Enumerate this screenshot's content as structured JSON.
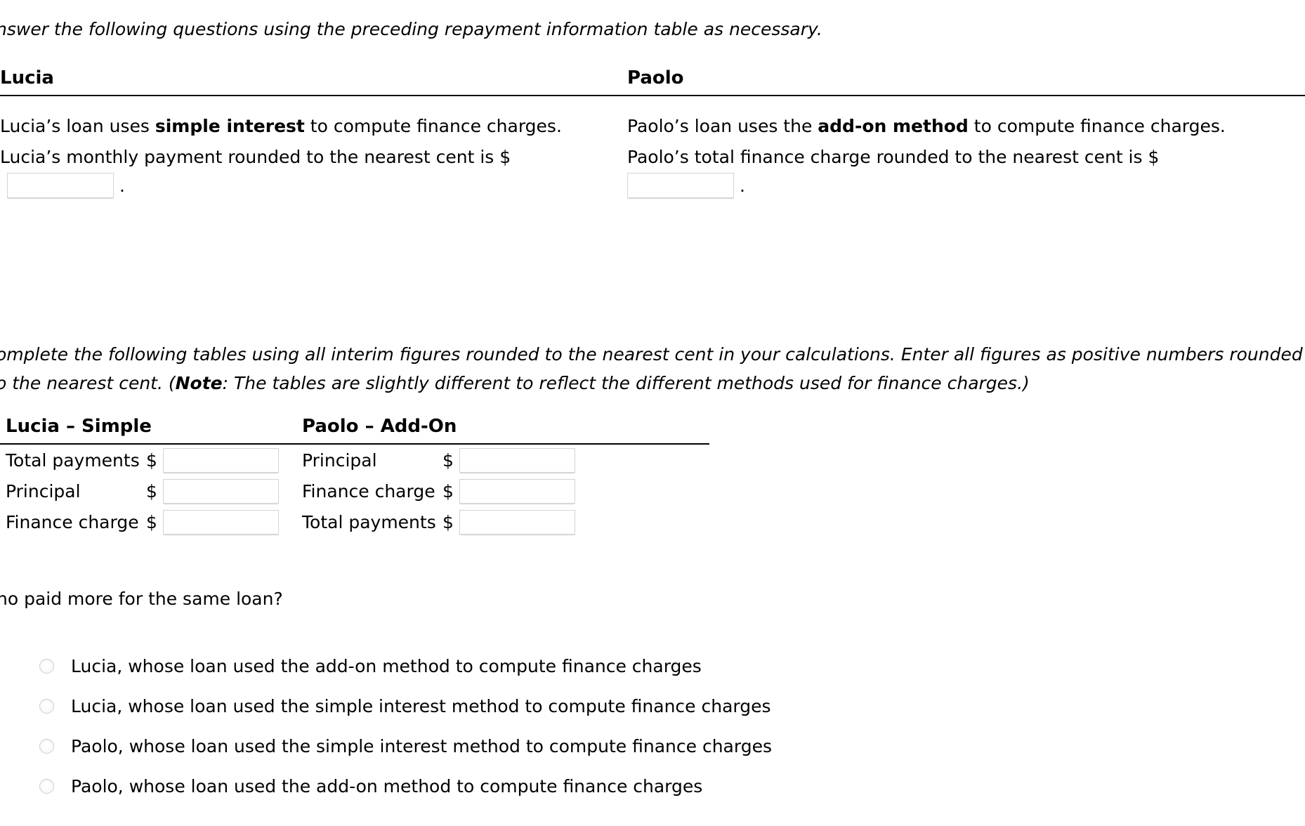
{
  "intro": {
    "text": "nswer the following questions using the preceding repayment information table as necessary."
  },
  "people": {
    "lucia": {
      "title": "Lucia",
      "method_line": "Lucia’s loan uses ",
      "method_bold": "simple interest",
      "method_line_end": " to compute finance charges.",
      "prompt": "Lucia’s monthly payment rounded to the nearest cent is $",
      "input_value": "",
      "trailing_period": "."
    },
    "paolo": {
      "title": "Paolo",
      "method_line": "Paolo’s loan uses the ",
      "method_bold": "add-on method",
      "method_line_end": " to compute finance charges.",
      "prompt": "Paolo’s total finance charge rounded to the nearest cent is $",
      "input_value": "",
      "trailing_period": "."
    }
  },
  "instructions": {
    "line1_a": "omplete the following tables using all interim figures rounded to the nearest cent in your calculations. Enter all figures as positive numbers rounded",
    "line2_a": "o the nearest cent. (",
    "line2_bold": "Note",
    "line2_b": ": The tables are slightly different to reflect the different methods used for finance charges.)"
  },
  "calc_tables": {
    "lucia": {
      "title": "Lucia – Simple",
      "rows": [
        {
          "label": "Total payments",
          "currency": "$",
          "value": ""
        },
        {
          "label": "Principal",
          "currency": "$",
          "value": ""
        },
        {
          "label": "Finance charge",
          "currency": "$",
          "value": ""
        }
      ]
    },
    "paolo": {
      "title": "Paolo – Add-On",
      "rows": [
        {
          "label": "Principal",
          "currency": "$",
          "value": ""
        },
        {
          "label": "Finance charge",
          "currency": "$",
          "value": ""
        },
        {
          "label": "Total payments",
          "currency": "$",
          "value": ""
        }
      ]
    }
  },
  "question": {
    "text": "ho paid more for the same loan?",
    "options": [
      {
        "label": "Lucia, whose loan used the add-on method to compute finance charges",
        "selected": false
      },
      {
        "label": "Lucia, whose loan used the simple interest method to compute finance charges",
        "selected": false
      },
      {
        "label": "Paolo, whose loan used the simple interest method to compute finance charges",
        "selected": false
      },
      {
        "label": "Paolo, whose loan used the add-on method to compute finance charges",
        "selected": false
      }
    ]
  },
  "colors": {
    "text": "#000000",
    "rule": "#000000",
    "input_border": "#d4d4d4",
    "radio_border": "#cfcfcf",
    "background": "#ffffff"
  }
}
